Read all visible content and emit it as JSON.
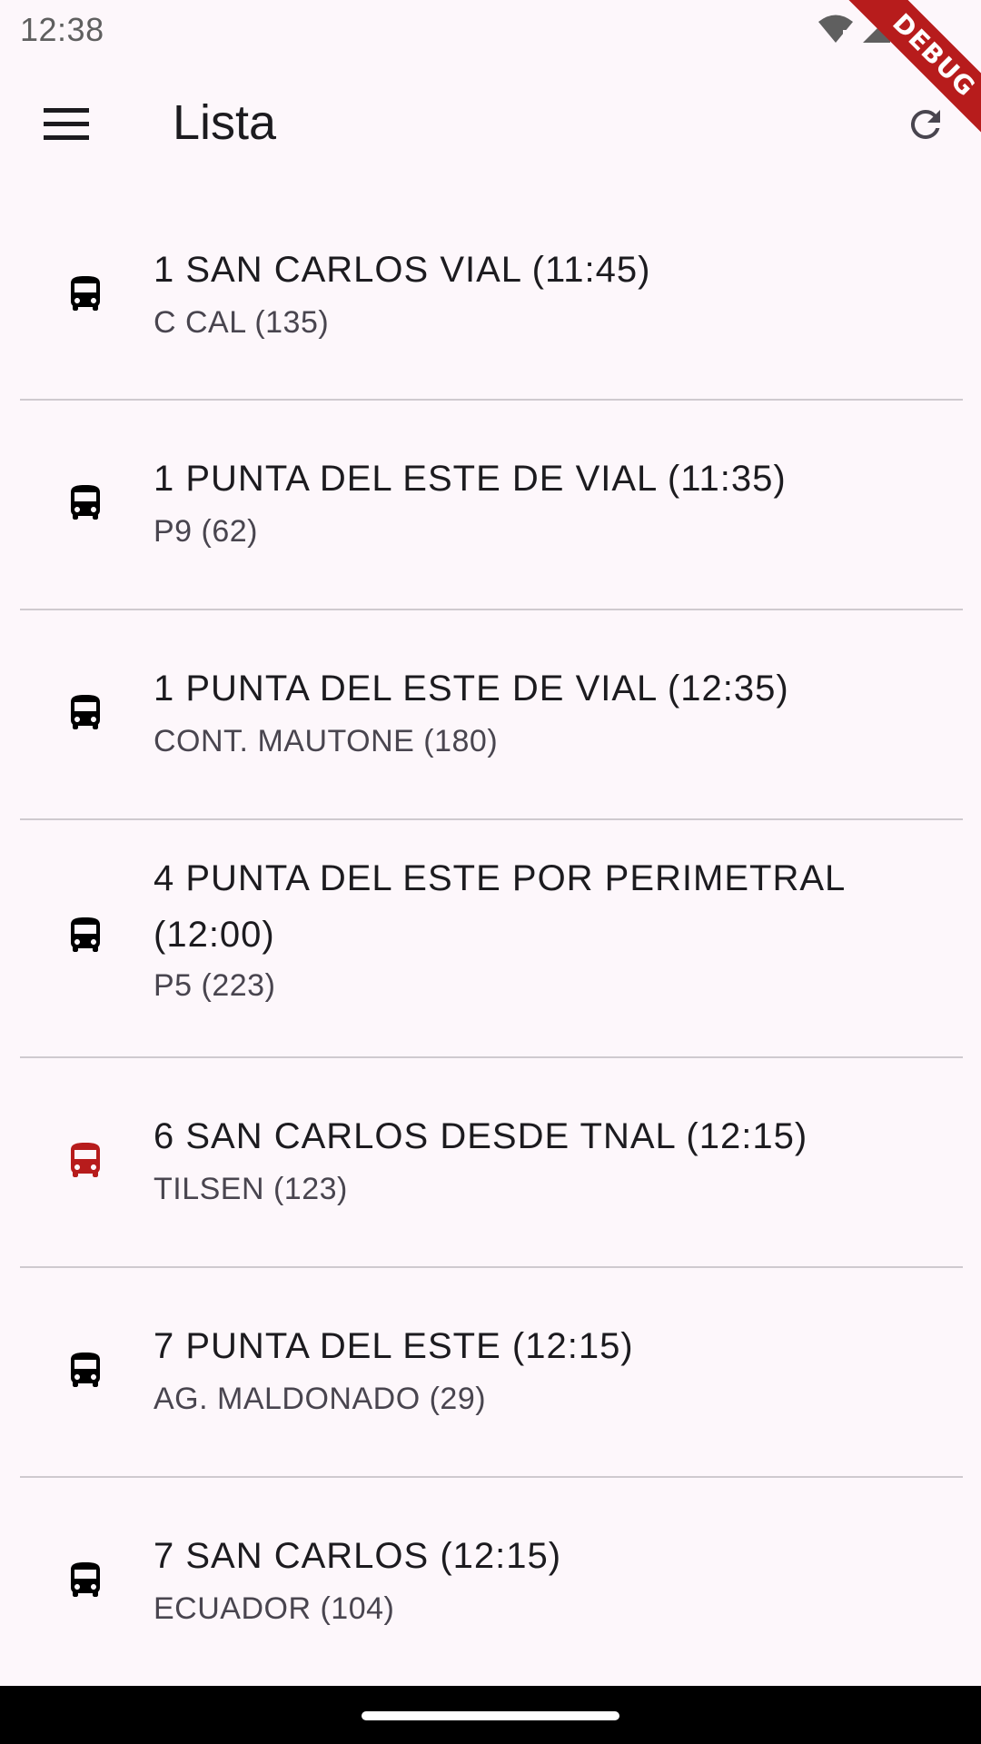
{
  "status_bar": {
    "time": "12:38"
  },
  "debug_banner": {
    "label": "DEBUG"
  },
  "app_bar": {
    "title": "Lista"
  },
  "items": [
    {
      "title": "1 SAN CARLOS VIAL (11:45)",
      "subtitle": "C CAL (135)",
      "icon_color": "#000000"
    },
    {
      "title": "1 PUNTA DEL ESTE DE VIAL (11:35)",
      "subtitle": "P9 (62)",
      "icon_color": "#000000"
    },
    {
      "title": "1 PUNTA DEL ESTE DE VIAL (12:35)",
      "subtitle": "CONT. MAUTONE (180)",
      "icon_color": "#000000"
    },
    {
      "title": "4 PUNTA DEL ESTE POR PERIMETRAL (12:00)",
      "subtitle": "P5 (223)",
      "icon_color": "#000000"
    },
    {
      "title": "6 SAN CARLOS DESDE TNAL (12:15)",
      "subtitle": "TILSEN (123)",
      "icon_color": "#b71c1c"
    },
    {
      "title": "7 PUNTA DEL ESTE (12:15)",
      "subtitle": "AG. MALDONADO (29)",
      "icon_color": "#000000"
    },
    {
      "title": "7 SAN CARLOS (12:15)",
      "subtitle": "ECUADOR (104)",
      "icon_color": "#000000"
    }
  ],
  "icons": {
    "menu": "menu-icon",
    "refresh": "refresh-icon",
    "bus": "bus-icon"
  }
}
